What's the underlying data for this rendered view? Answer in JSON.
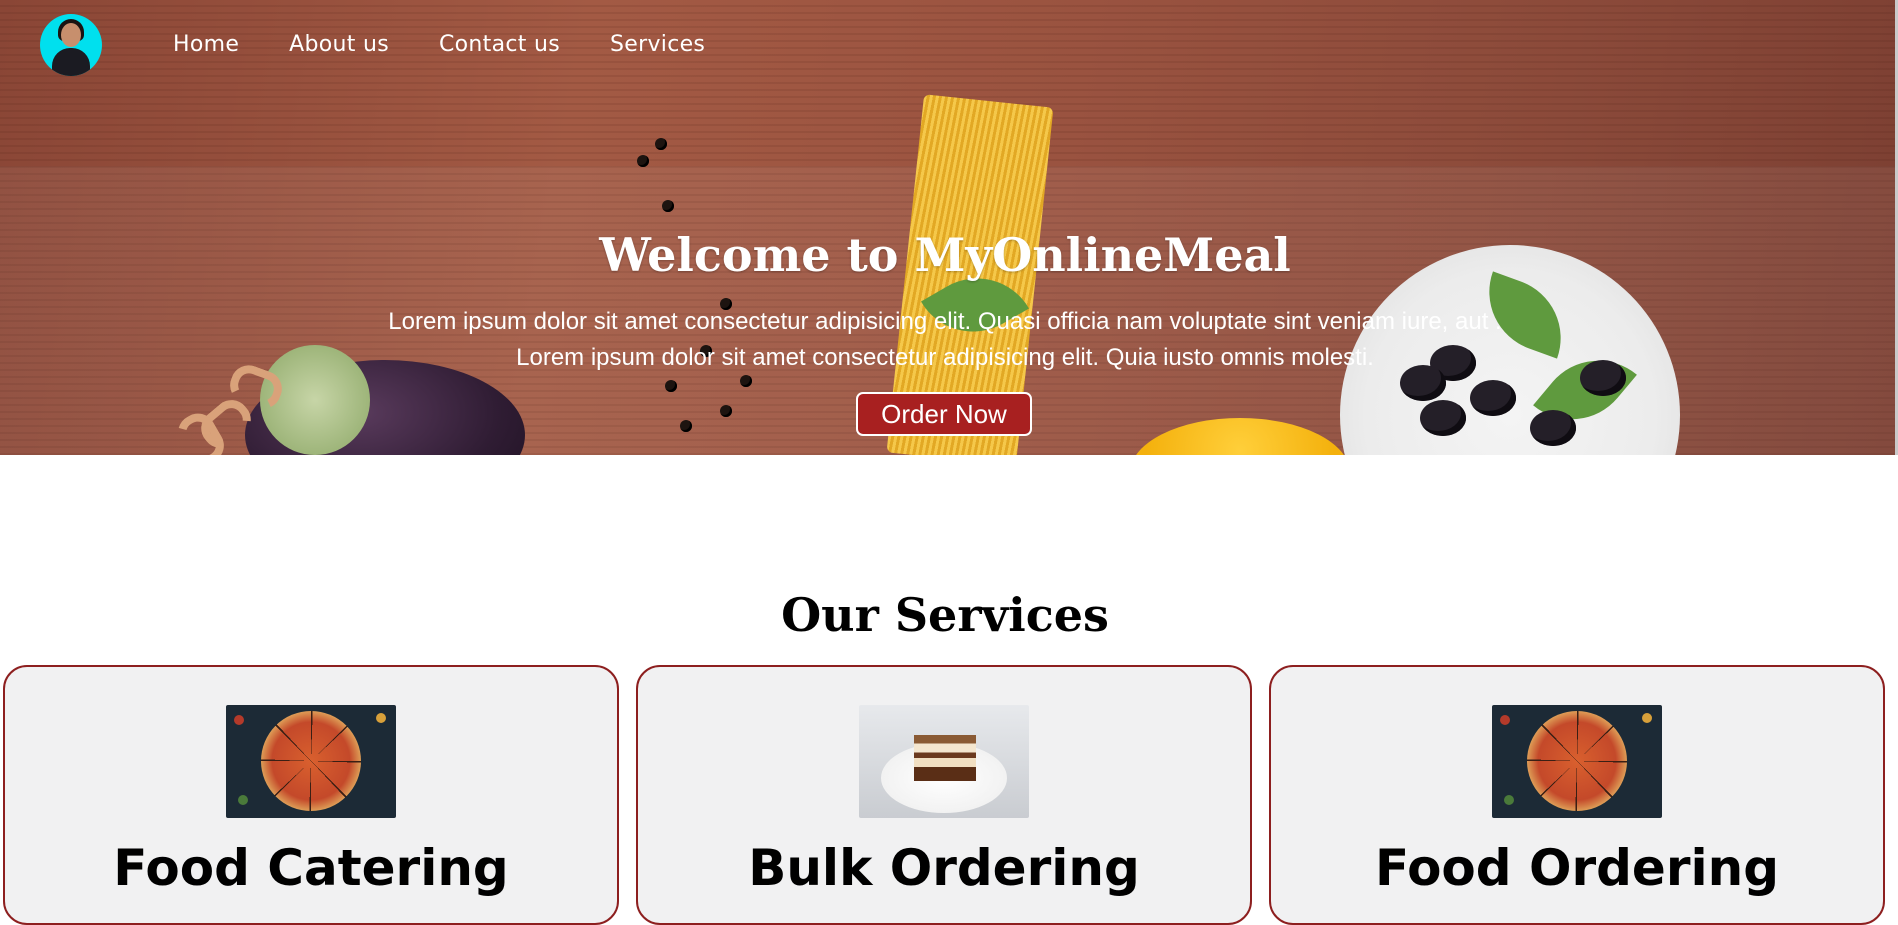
{
  "nav": {
    "avatar_icon": "profile-avatar",
    "items": [
      {
        "label": "Home"
      },
      {
        "label": "About us"
      },
      {
        "label": "Contact us"
      },
      {
        "label": "Services"
      }
    ]
  },
  "hero": {
    "title": "Welcome to MyOnlineMeal",
    "line1": "Lorem ipsum dolor sit amet consectetur adipisicing elit. Quasi officia nam voluptate sint veniam iure, aut .",
    "line2": "Lorem ipsum dolor sit amet consectetur adipisicing elit. Quia iusto omnis molesti.",
    "cta_label": "Order Now",
    "background": "food-on-wooden-table"
  },
  "services": {
    "title": "Our Services",
    "cards": [
      {
        "title": "Food Catering",
        "image": "pizza-image"
      },
      {
        "title": "Bulk Ordering",
        "image": "cake-image"
      },
      {
        "title": "Food Ordering",
        "image": "pizza-image"
      }
    ]
  },
  "colors": {
    "accent": "#a82020",
    "card_border": "#8d1f1f",
    "card_bg": "#f1f1f2",
    "avatar_bg": "#00e0ee"
  }
}
